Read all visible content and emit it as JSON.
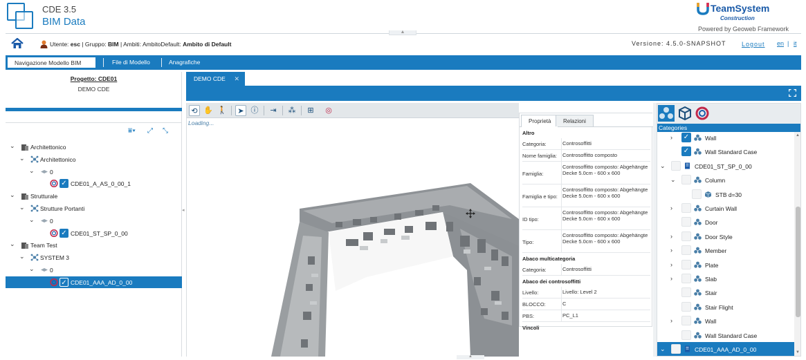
{
  "app": {
    "version": "CDE 3.5",
    "name": "BIM Data",
    "brand_name": "TeamSystem",
    "brand_sub": "Construction",
    "brand_powered": "Powered by Geoweb Framework"
  },
  "userbar": {
    "user_label": "Utente:",
    "user": "esc",
    "group_label": "| Gruppo:",
    "group": "BIM",
    "scope_label": "| Ambiti: AmbitoDefault:",
    "scope": "Ambito di Default",
    "version_text": "Versione: 4.5.0-SNAPSHOT",
    "logout": "Logout",
    "lang_en": "en",
    "lang_sep": "|",
    "lang_it": "it"
  },
  "nav": {
    "tabs": [
      "Navigazione Modello BIM",
      "File di Modello",
      "Anagrafiche"
    ],
    "active": 0
  },
  "left": {
    "project_label": "Progetto: CDE01",
    "project_desc": "DEMO CDE",
    "tree": [
      {
        "level": 0,
        "chev": "expanded",
        "label": "Architettonico",
        "icon": "building-icon"
      },
      {
        "level": 1,
        "chev": "expanded",
        "label": "Architettonico",
        "icon": "network-icon"
      },
      {
        "level": 2,
        "chev": "expanded",
        "label": "0",
        "icon": "layer-icon"
      },
      {
        "level": 3,
        "chev": "none",
        "label": "CDE01_A_AS_0_00_1",
        "icon": "model-icon",
        "checked": true
      },
      {
        "level": 0,
        "chev": "expanded",
        "label": "Strutturale",
        "icon": "building-icon"
      },
      {
        "level": 1,
        "chev": "expanded",
        "label": "Strutture Portanti",
        "icon": "network-icon"
      },
      {
        "level": 2,
        "chev": "expanded",
        "label": "0",
        "icon": "layer-icon"
      },
      {
        "level": 3,
        "chev": "none",
        "label": "CDE01_ST_SP_0_00",
        "icon": "model-icon",
        "checked": true
      },
      {
        "level": 0,
        "chev": "expanded",
        "label": "Team Test",
        "icon": "building-icon"
      },
      {
        "level": 1,
        "chev": "expanded",
        "label": "SYSTEM 3",
        "icon": "network-icon"
      },
      {
        "level": 2,
        "chev": "expanded",
        "label": "0",
        "icon": "layer-icon"
      },
      {
        "level": 3,
        "chev": "none",
        "label": "CDE01_AAA_AD_0_00",
        "icon": "model-icon",
        "checked": true,
        "selected": true
      }
    ]
  },
  "center": {
    "doc_tab": "DEMO CDE",
    "loading": "Loading...",
    "props": {
      "tabs": [
        "Proprietà",
        "Relazioni"
      ],
      "sections": [
        {
          "title": "Altro",
          "rows": [
            {
              "k": "Categoria:",
              "v": "Controsoffitti"
            },
            {
              "k": "Nome famiglia:",
              "v": "Controsoffitto composto"
            },
            {
              "k": "Famiglia:",
              "v": "Controsoffitto composto: Abgehängte Decke 5.0cm - 600 x 600"
            },
            {
              "k": "Famiglia e tipo:",
              "v": "Controsoffitto composto: Abgehängte Decke 5.0cm - 600 x 600"
            },
            {
              "k": "ID tipo:",
              "v": "Controsoffitto composto: Abgehängte Decke 5.0cm - 600 x 600"
            },
            {
              "k": "Tipo:",
              "v": "Controsoffitto composto: Abgehängte Decke 5.0cm - 600 x 600"
            }
          ]
        },
        {
          "title": "Abaco multicategoria",
          "rows": [
            {
              "k": "Categoria:",
              "v": "Controsoffitti"
            }
          ]
        },
        {
          "title": "Abaco dei controsoffitti",
          "rows": [
            {
              "k": "Livello:",
              "v": "Livello: Level 2"
            },
            {
              "k": "BLOCCO:",
              "v": "C"
            },
            {
              "k": "PBS:",
              "v": "PC_L1"
            }
          ]
        },
        {
          "title": "Vincoli",
          "rows": []
        }
      ]
    }
  },
  "categories": {
    "header": "Categories",
    "rows": [
      {
        "level": 1,
        "chev": "collapsed",
        "checked": true,
        "icon": "category-icon",
        "label": "Wall"
      },
      {
        "level": 1,
        "chev": "none",
        "checked": true,
        "icon": "category-icon",
        "label": "Wall Standard Case"
      },
      {
        "level": 0,
        "chev": "expanded",
        "checked": false,
        "icon": "model-file-icon",
        "label": "CDE01_ST_SP_0_00"
      },
      {
        "level": 1,
        "chev": "expanded",
        "checked": false,
        "icon": "category-icon",
        "label": "Column"
      },
      {
        "level": 2,
        "chev": "none",
        "checked": false,
        "icon": "cube-icon",
        "label": "STB d=30"
      },
      {
        "level": 1,
        "chev": "collapsed",
        "checked": false,
        "icon": "category-icon",
        "label": "Curtain Wall"
      },
      {
        "level": 1,
        "chev": "none",
        "checked": false,
        "icon": "category-icon",
        "label": "Door"
      },
      {
        "level": 1,
        "chev": "collapsed",
        "checked": false,
        "icon": "category-icon",
        "label": "Door Style"
      },
      {
        "level": 1,
        "chev": "collapsed",
        "checked": false,
        "icon": "category-icon",
        "label": "Member"
      },
      {
        "level": 1,
        "chev": "collapsed",
        "checked": false,
        "icon": "category-icon",
        "label": "Plate"
      },
      {
        "level": 1,
        "chev": "collapsed",
        "checked": false,
        "icon": "category-icon",
        "label": "Slab"
      },
      {
        "level": 1,
        "chev": "none",
        "checked": false,
        "icon": "category-icon",
        "label": "Stair"
      },
      {
        "level": 1,
        "chev": "none",
        "checked": false,
        "icon": "category-icon",
        "label": "Stair Flight"
      },
      {
        "level": 1,
        "chev": "collapsed",
        "checked": false,
        "icon": "category-icon",
        "label": "Wall"
      },
      {
        "level": 1,
        "chev": "none",
        "checked": false,
        "icon": "category-icon",
        "label": "Wall Standard Case"
      },
      {
        "level": 0,
        "chev": "expanded",
        "checked": false,
        "icon": "model-file-icon",
        "label": "CDE01_AAA_AD_0_00",
        "selected": true
      }
    ]
  },
  "colors": {
    "accent": "#1a7bbf",
    "brand": "#1a5aa8"
  }
}
